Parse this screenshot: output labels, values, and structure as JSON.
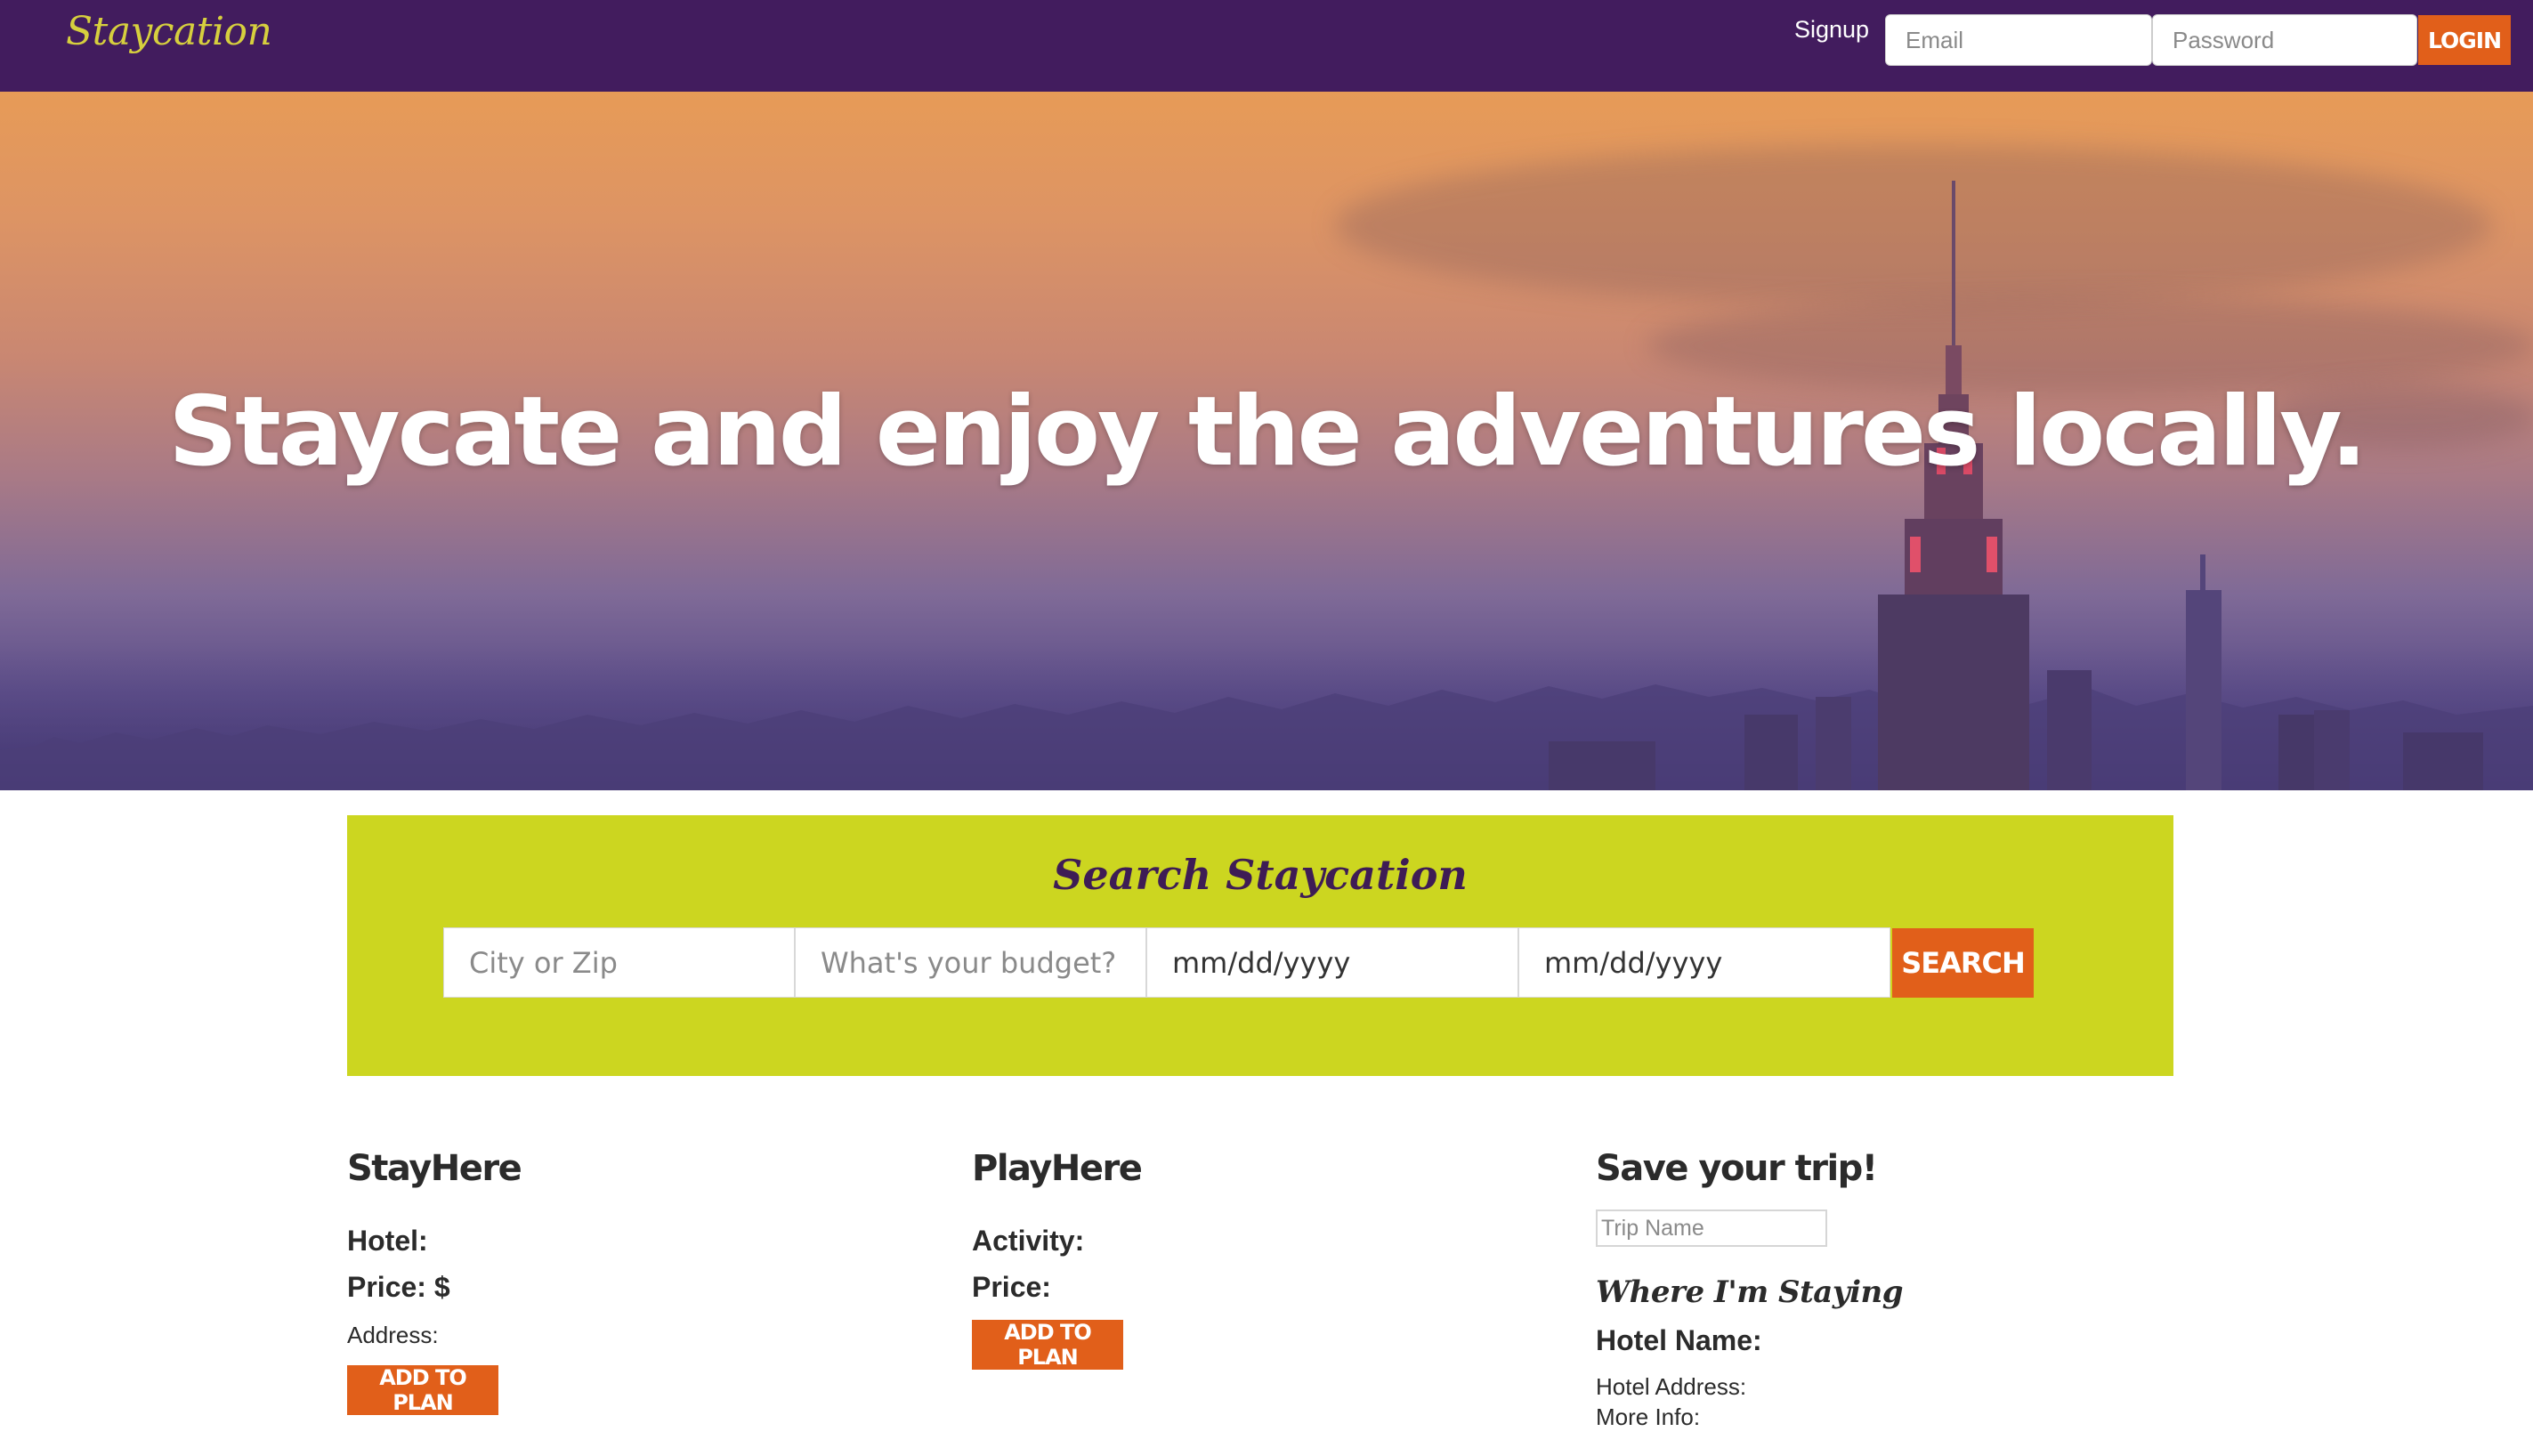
{
  "navbar": {
    "brand": "Staycation",
    "signup": "Signup",
    "email_placeholder": "Email",
    "password_placeholder": "Password",
    "login_label": "LOGIN"
  },
  "hero": {
    "title": "Staycate and enjoy the adventures locally."
  },
  "search": {
    "title": "Search Staycation",
    "city_placeholder": "City or Zip",
    "budget_placeholder": "What's your budget?",
    "start_date": "mm/dd/yyyy",
    "end_date": "mm/dd/yyyy",
    "button_label": "SEARCH"
  },
  "stay": {
    "title": "StayHere",
    "hotel_label": "Hotel:",
    "price_label": "Price: $",
    "address_label": "Address:",
    "button_label": "ADD TO PLAN"
  },
  "play": {
    "title": "PlayHere",
    "activity_label": "Activity:",
    "price_label": "Price:",
    "button_label": "ADD TO PLAN"
  },
  "save": {
    "title": "Save your trip!",
    "trip_placeholder": "Trip Name",
    "staying_title": "Where I'm Staying",
    "hotel_name_label": "Hotel Name:",
    "hotel_address_label": "Hotel Address:",
    "more_info_label": "More Info:"
  },
  "colors": {
    "navbar": "#421c5e",
    "brand": "#d6cf3e",
    "accent": "#e15f1a",
    "search_bg": "#ccd620",
    "search_title": "#3e1c55"
  }
}
